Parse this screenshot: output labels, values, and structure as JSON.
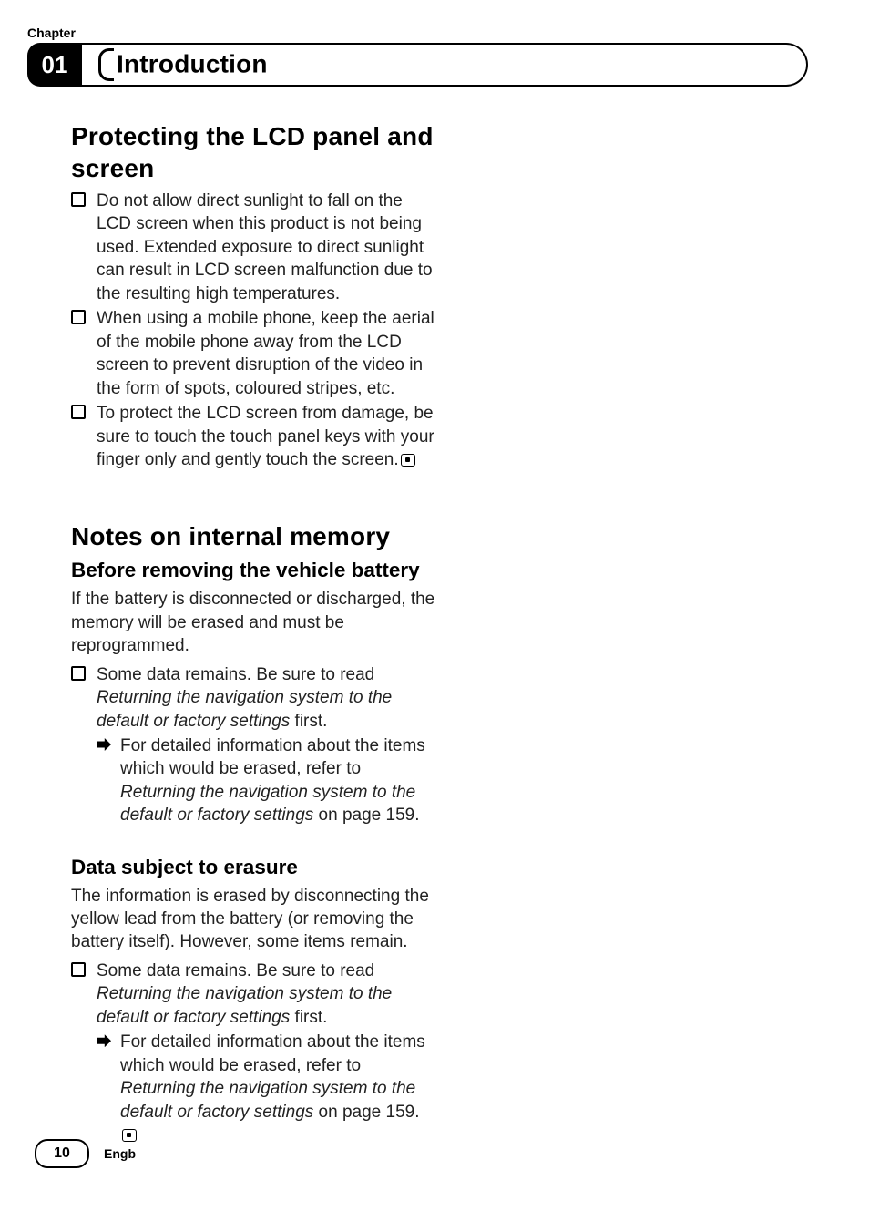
{
  "header": {
    "chapter_label": "Chapter",
    "chapter_number": "01",
    "title": "Introduction"
  },
  "section1": {
    "heading": "Protecting the LCD panel and screen",
    "items": [
      "Do not allow direct sunlight to fall on the LCD screen when this product is not being used. Extended exposure to direct sunlight can result in LCD screen malfunction due to the resulting high temperatures.",
      "When using a mobile phone, keep the aerial of the mobile phone away from the LCD screen to prevent disruption of the video in the form of spots, coloured stripes, etc.",
      "To protect the LCD screen from damage, be sure to touch the touch panel keys with your finger only and gently touch the screen."
    ]
  },
  "section2": {
    "heading": "Notes on internal memory",
    "sub1": {
      "heading": "Before removing the vehicle battery",
      "para": "If the battery is disconnected or discharged, the memory will be erased and must be reprogrammed.",
      "bullet_prefix": "Some data remains. Be sure to read ",
      "bullet_ital": "Returning the navigation system to the default or factory settings",
      "bullet_suffix": " first.",
      "nested_prefix": "For detailed information about the items which would be erased, refer to ",
      "nested_ital": "Returning the navigation system to the default or factory settings",
      "nested_suffix": " on page 159."
    },
    "sub2": {
      "heading": "Data subject to erasure",
      "para": "The information is erased by disconnecting the yellow lead from the battery (or removing the battery itself). However, some items remain.",
      "bullet_prefix": "Some data remains. Be sure to read ",
      "bullet_ital": "Returning the navigation system to the default or factory settings",
      "bullet_suffix": " first.",
      "nested_prefix": "For detailed information about the items which would be erased, refer to ",
      "nested_ital": "Returning the navigation system to the default or factory settings",
      "nested_suffix": " on page 159."
    }
  },
  "footer": {
    "page_number": "10",
    "lang": "Engb"
  }
}
